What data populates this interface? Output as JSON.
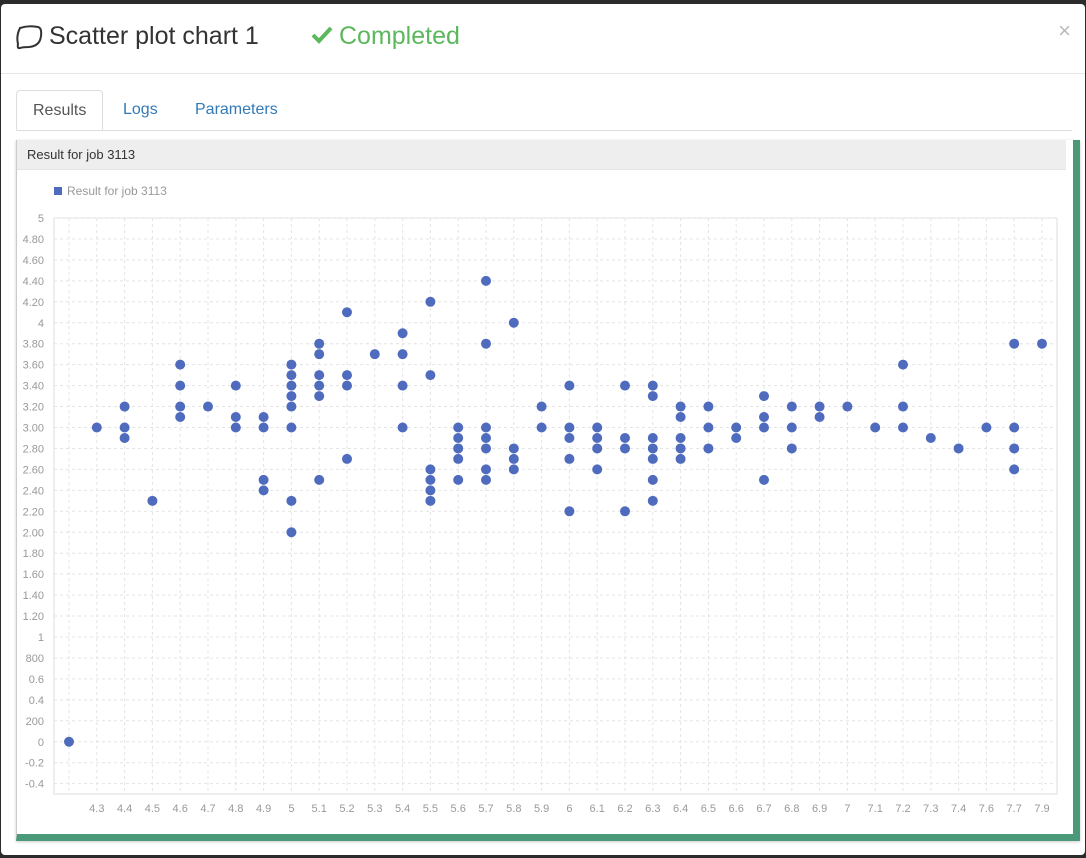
{
  "header": {
    "title": "Scatter plot chart 1",
    "status": "Completed",
    "title_icon": "chat-bubble-icon",
    "status_icon": "check-icon",
    "close_label": "×",
    "status_color": "#5cb85c"
  },
  "tabs": [
    "Results",
    "Logs",
    "Parameters"
  ],
  "panel": {
    "heading": "Result for job 3113"
  },
  "chart_data": {
    "type": "scatter",
    "title": "",
    "xlabel": "",
    "ylabel": "",
    "grid": true,
    "legend_position": "top-left",
    "series": [
      {
        "name": "Result for job 3113",
        "color": "#4f6bbd",
        "points": [
          [
            4.2,
            0
          ],
          [
            4.3,
            3.0
          ],
          [
            4.4,
            3.2
          ],
          [
            4.4,
            3.0
          ],
          [
            4.4,
            2.9
          ],
          [
            4.5,
            2.3
          ],
          [
            4.6,
            3.6
          ],
          [
            4.6,
            3.4
          ],
          [
            4.6,
            3.2
          ],
          [
            4.6,
            3.1
          ],
          [
            4.7,
            3.2
          ],
          [
            4.8,
            3.4
          ],
          [
            4.8,
            3.1
          ],
          [
            4.8,
            3.0
          ],
          [
            4.9,
            3.1
          ],
          [
            4.9,
            3.0
          ],
          [
            4.9,
            2.5
          ],
          [
            4.9,
            2.4
          ],
          [
            5.0,
            3.6
          ],
          [
            5.0,
            3.5
          ],
          [
            5.0,
            3.4
          ],
          [
            5.0,
            3.3
          ],
          [
            5.0,
            3.2
          ],
          [
            5.0,
            3.0
          ],
          [
            5.0,
            2.3
          ],
          [
            5.0,
            2.0
          ],
          [
            5.1,
            3.8
          ],
          [
            5.1,
            3.7
          ],
          [
            5.1,
            3.5
          ],
          [
            5.1,
            3.4
          ],
          [
            5.1,
            3.3
          ],
          [
            5.1,
            2.5
          ],
          [
            5.2,
            4.1
          ],
          [
            5.2,
            3.5
          ],
          [
            5.2,
            3.4
          ],
          [
            5.2,
            2.7
          ],
          [
            5.3,
            3.7
          ],
          [
            5.4,
            3.9
          ],
          [
            5.4,
            3.7
          ],
          [
            5.4,
            3.4
          ],
          [
            5.4,
            3.0
          ],
          [
            5.5,
            4.2
          ],
          [
            5.5,
            3.5
          ],
          [
            5.5,
            2.6
          ],
          [
            5.5,
            2.5
          ],
          [
            5.5,
            2.4
          ],
          [
            5.5,
            2.3
          ],
          [
            5.6,
            3.0
          ],
          [
            5.6,
            2.9
          ],
          [
            5.6,
            2.8
          ],
          [
            5.6,
            2.7
          ],
          [
            5.6,
            2.5
          ],
          [
            5.7,
            4.4
          ],
          [
            5.7,
            3.8
          ],
          [
            5.7,
            3.0
          ],
          [
            5.7,
            2.9
          ],
          [
            5.7,
            2.8
          ],
          [
            5.7,
            2.6
          ],
          [
            5.7,
            2.5
          ],
          [
            5.8,
            4.0
          ],
          [
            5.8,
            2.8
          ],
          [
            5.8,
            2.7
          ],
          [
            5.8,
            2.6
          ],
          [
            5.9,
            3.2
          ],
          [
            5.9,
            3.0
          ],
          [
            6.0,
            3.4
          ],
          [
            6.0,
            3.0
          ],
          [
            6.0,
            2.9
          ],
          [
            6.0,
            2.7
          ],
          [
            6.0,
            2.2
          ],
          [
            6.1,
            3.0
          ],
          [
            6.1,
            2.9
          ],
          [
            6.1,
            2.8
          ],
          [
            6.1,
            2.6
          ],
          [
            6.2,
            3.4
          ],
          [
            6.2,
            2.9
          ],
          [
            6.2,
            2.8
          ],
          [
            6.2,
            2.2
          ],
          [
            6.3,
            3.4
          ],
          [
            6.3,
            3.3
          ],
          [
            6.3,
            2.9
          ],
          [
            6.3,
            2.8
          ],
          [
            6.3,
            2.7
          ],
          [
            6.3,
            2.5
          ],
          [
            6.3,
            2.3
          ],
          [
            6.4,
            3.2
          ],
          [
            6.4,
            3.1
          ],
          [
            6.4,
            2.9
          ],
          [
            6.4,
            2.8
          ],
          [
            6.4,
            2.7
          ],
          [
            6.5,
            3.2
          ],
          [
            6.5,
            3.0
          ],
          [
            6.5,
            2.8
          ],
          [
            6.6,
            3.0
          ],
          [
            6.6,
            2.9
          ],
          [
            6.7,
            3.3
          ],
          [
            6.7,
            3.1
          ],
          [
            6.7,
            3.0
          ],
          [
            6.7,
            2.5
          ],
          [
            6.8,
            3.2
          ],
          [
            6.8,
            3.0
          ],
          [
            6.8,
            2.8
          ],
          [
            6.9,
            3.2
          ],
          [
            6.9,
            3.1
          ],
          [
            7.0,
            3.2
          ],
          [
            7.1,
            3.0
          ],
          [
            7.2,
            3.6
          ],
          [
            7.2,
            3.2
          ],
          [
            7.2,
            3.0
          ],
          [
            7.3,
            2.9
          ],
          [
            7.4,
            2.8
          ],
          [
            7.6,
            3.0
          ],
          [
            7.7,
            3.8
          ],
          [
            7.7,
            3.0
          ],
          [
            7.7,
            2.8
          ],
          [
            7.7,
            2.6
          ],
          [
            7.9,
            3.8
          ]
        ]
      }
    ],
    "x_ticks": [
      "4.3",
      "4.4",
      "4.5",
      "4.6",
      "4.7",
      "4.8",
      "4.9",
      "5",
      "5.1",
      "5.2",
      "5.3",
      "5.4",
      "5.5",
      "5.6",
      "5.7",
      "5.8",
      "5.9",
      "6",
      "6.1",
      "6.2",
      "6.3",
      "6.4",
      "6.5",
      "6.6",
      "6.7",
      "6.8",
      "6.9",
      "7",
      "7.1",
      "7.2",
      "7.3",
      "7.4",
      "7.6",
      "7.7",
      "7.9"
    ],
    "y_ticks": [
      "5",
      "4.80",
      "4.60",
      "4.40",
      "4.20",
      "4",
      "3.80",
      "3.60",
      "3.40",
      "3.20",
      "3.00",
      "2.80",
      "2.60",
      "2.40",
      "2.20",
      "2.00",
      "1.80",
      "1.60",
      "1.40",
      "1.20",
      "1",
      "800",
      "0.6",
      "0.4",
      "200",
      "0",
      "-0.2",
      "-0.4"
    ],
    "ylim": [
      -0.5,
      5
    ]
  }
}
